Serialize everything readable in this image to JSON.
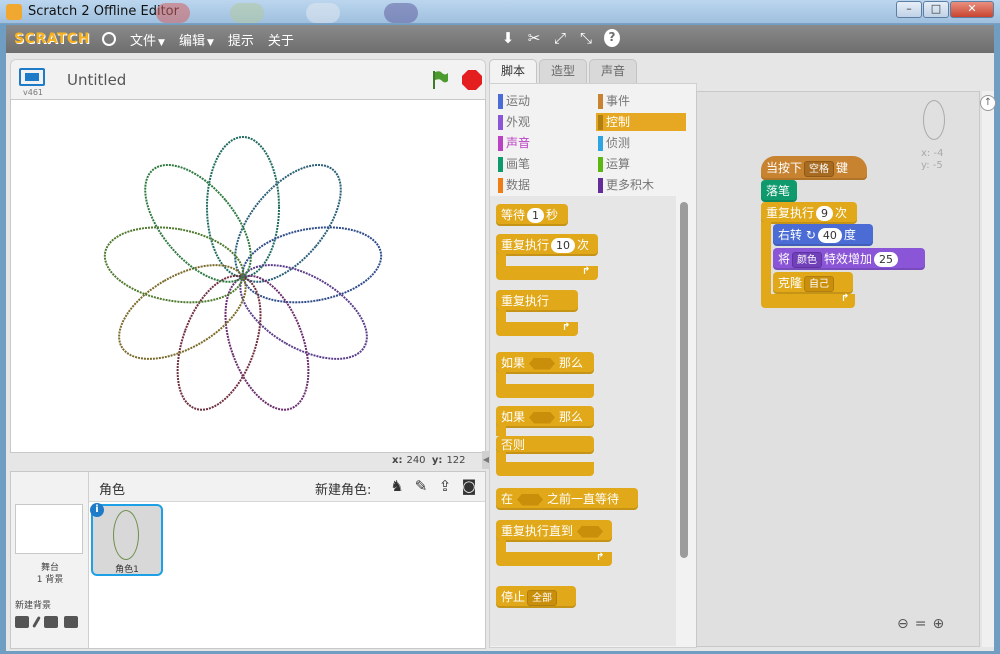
{
  "window": {
    "title": "Scratch 2 Offline Editor"
  },
  "menubar": {
    "logo": "SCRATCH",
    "items": [
      "文件",
      "编辑",
      "提示",
      "关于"
    ]
  },
  "stage": {
    "version": "v461",
    "project_title": "Untitled",
    "x_label": "x:",
    "x_value": "240",
    "y_label": "y:",
    "y_value": "122"
  },
  "sprites": {
    "header": "角色",
    "new_sprite_label": "新建角色:",
    "stage_label": "舞台",
    "backdrop_count": "1 背景",
    "new_backdrop_label": "新建背景",
    "sprite1_name": "角色1"
  },
  "tabs": [
    "脚本",
    "造型",
    "声音"
  ],
  "categories": [
    {
      "label": "运动",
      "color": "#4a6cd4"
    },
    {
      "label": "外观",
      "color": "#8a55d7"
    },
    {
      "label": "声音",
      "color": "#bb42c3"
    },
    {
      "label": "画笔",
      "color": "#0e9a6c"
    },
    {
      "label": "数据",
      "color": "#ee7d16"
    },
    {
      "label": "事件",
      "color": "#c88330"
    },
    {
      "label": "控制",
      "color": "#e1a91a"
    },
    {
      "label": "侦测",
      "color": "#2ca5e2"
    },
    {
      "label": "运算",
      "color": "#5cb712"
    },
    {
      "label": "更多积木",
      "color": "#632d99"
    }
  ],
  "palette_blocks": {
    "wait": "等待",
    "wait_value": "1",
    "wait_unit": "秒",
    "repeat": "重复执行",
    "repeat_value": "10",
    "repeat_unit": "次",
    "forever": "重复执行",
    "if": "如果",
    "then": "那么",
    "if2": "如果",
    "then2": "那么",
    "else": "否则",
    "wait_until_1": "在",
    "wait_until_2": "之前一直等待",
    "repeat_until": "重复执行直到",
    "stop": "停止",
    "stop_option": "全部"
  },
  "script": {
    "hat_label_1": "当按下",
    "hat_key": "空格",
    "hat_label_2": "键",
    "pen_down": "落笔",
    "repeat_label": "重复执行",
    "repeat_count": "9",
    "repeat_unit": "次",
    "turn_label": "右转",
    "turn_value": "40",
    "turn_unit": "度",
    "effect_label_1": "将",
    "effect_option": "颜色",
    "effect_label_2": "特效增加",
    "effect_value": "25",
    "clone_label": "克隆",
    "clone_option": "自己"
  },
  "sprite_info": {
    "x": "x: -4",
    "y": "y: -5"
  },
  "colors": {
    "control": "#e1a91a",
    "events": "#c88330",
    "pen": "#0e9a6c",
    "motion": "#4a6cd4",
    "looks": "#8a55d7",
    "selection": "#1ea0e6"
  }
}
